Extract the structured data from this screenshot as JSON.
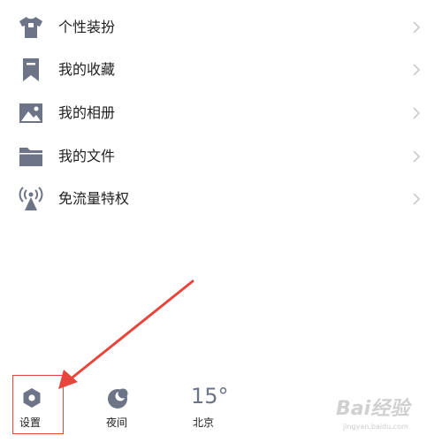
{
  "menu": {
    "items": [
      {
        "label": "个性装扮",
        "icon": "tshirt-icon"
      },
      {
        "label": "我的收藏",
        "icon": "bookmark-icon"
      },
      {
        "label": "我的相册",
        "icon": "image-icon"
      },
      {
        "label": "我的文件",
        "icon": "folder-icon"
      },
      {
        "label": "免流量特权",
        "icon": "signal-tower-icon"
      }
    ],
    "chevron_icon": "chevron-right-icon"
  },
  "bottom_bar": {
    "settings": {
      "label": "设置",
      "icon": "settings-hexagon-icon"
    },
    "night": {
      "label": "夜间",
      "icon": "moon-icon"
    },
    "weather": {
      "temperature": "15°",
      "city": "北京"
    }
  },
  "annotation": {
    "arrow_color": "#e8453c",
    "box_color": "#e8453c"
  },
  "watermark": {
    "text": "Bai经验",
    "subtext": "jingyan.baidu.com"
  },
  "colors": {
    "icon": "#6e7487",
    "text": "#1f1f1f",
    "chevron": "#c6c6c6",
    "background": "#ffffff"
  }
}
